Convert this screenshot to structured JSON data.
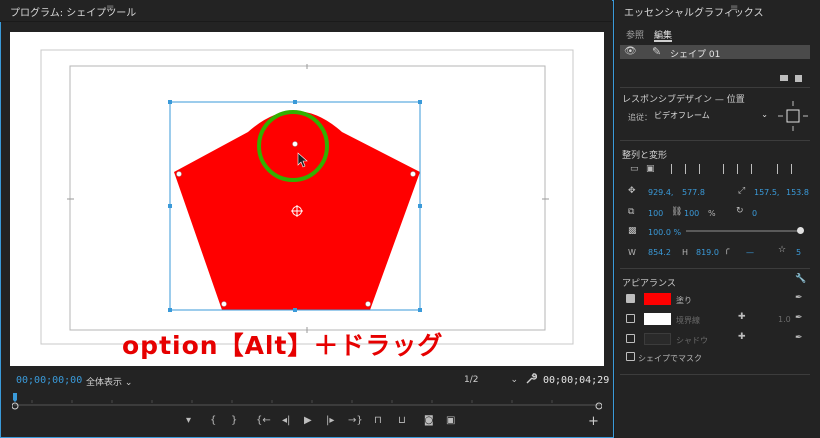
{
  "program": {
    "title": "プログラム: シェイプツール",
    "menu": "≡",
    "timecode_left": "00;00;00;00",
    "fit": "全体表示",
    "resolution": "1/2",
    "timecode_right": "00;00;04;29",
    "overlay": "option【Alt】＋ドラッグ",
    "add": "+"
  },
  "shape": {
    "fill_color": "#ff0000",
    "circle_color": "#33b000",
    "bbox_color": "#3a9ad9"
  },
  "eg": {
    "title": "エッセンシャルグラフィックス",
    "menu": "≡",
    "tabs": [
      "参照",
      "編集"
    ],
    "layer_name": "シェイプ 01",
    "responsive_title": "レスポンシブデザイン — 位置",
    "pin_label": "追従：",
    "pin_value": "ビデオフレーム",
    "align_title": "整列と変形",
    "position_x": "929.4",
    "position_x_suffix": ",",
    "position_y": "577.8",
    "anchor_x": "157.5",
    "anchor_x_suffix": ",",
    "anchor_y": "153.8",
    "scale_w": "100",
    "scale_h": "100",
    "scale_unit": "%",
    "rotation": "0",
    "opacity": "100.0 %",
    "w_label": "W",
    "w_value": "854.2",
    "h_label": "H",
    "h_value": "819.0",
    "corner_value": "—",
    "sides_value": "5",
    "appearance_title": "アピアランス",
    "fill_label": "塗り",
    "stroke_label": "境界線",
    "stroke_value": "1.0",
    "shadow_label": "シャドウ",
    "mask_label": "シェイプでマスク",
    "fill_swatch": "#ff0000",
    "stroke_swatch": "#ffffff",
    "shadow_swatch": "#2a2a2a"
  }
}
